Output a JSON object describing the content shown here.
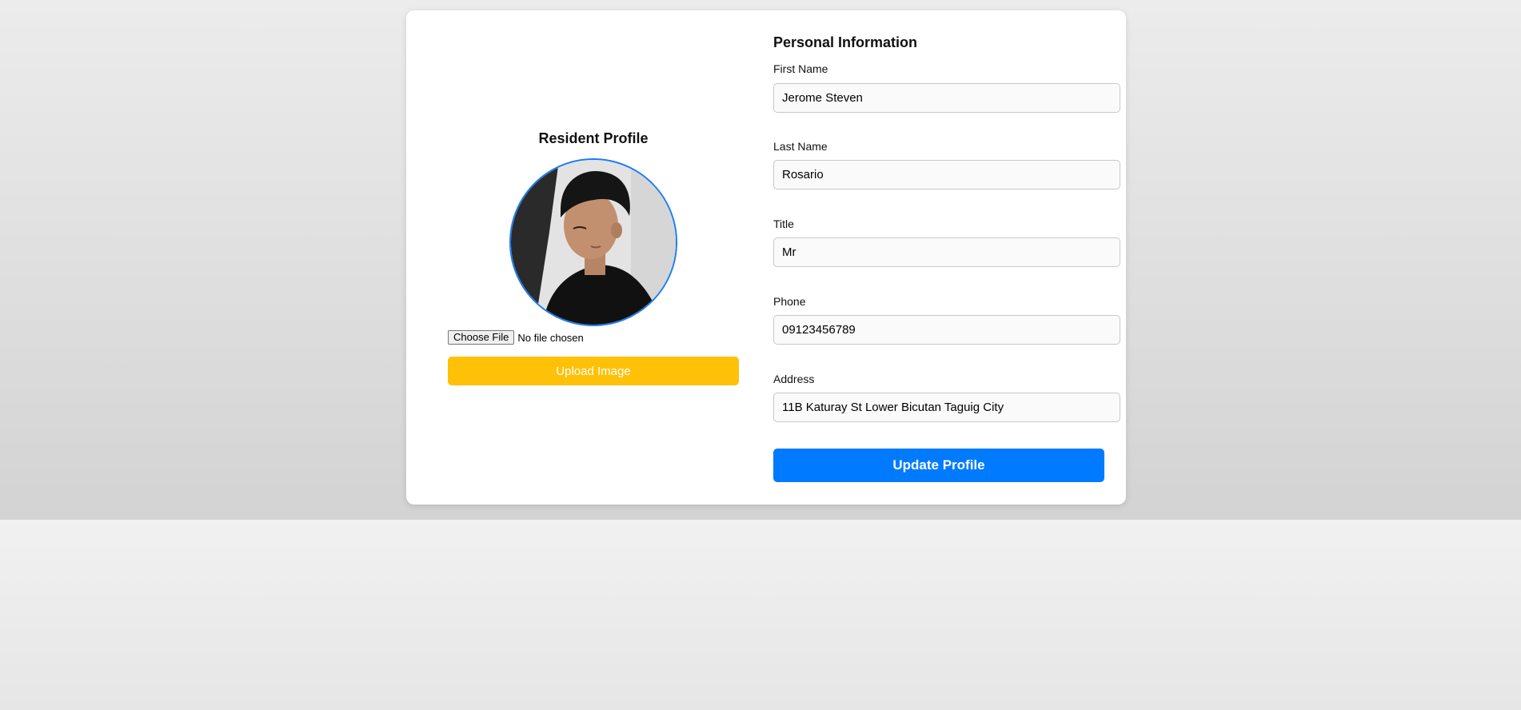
{
  "profile": {
    "title": "Resident Profile",
    "file_button_label": "Choose File",
    "file_status": "No file chosen",
    "upload_label": "Upload Image"
  },
  "personal": {
    "title": "Personal Information",
    "fields": [
      {
        "label": "First Name",
        "value": "Jerome Steven"
      },
      {
        "label": "Last Name",
        "value": "Rosario"
      },
      {
        "label": "Title",
        "value": "Mr"
      },
      {
        "label": "Phone",
        "value": "09123456789"
      },
      {
        "label": "Address",
        "value": "11B Katuray St Lower Bicutan Taguig City"
      }
    ],
    "update_label": "Update Profile"
  },
  "colors": {
    "upload_button": "#ffc107",
    "update_button": "#007bff",
    "avatar_border": "#1a7cf5"
  }
}
